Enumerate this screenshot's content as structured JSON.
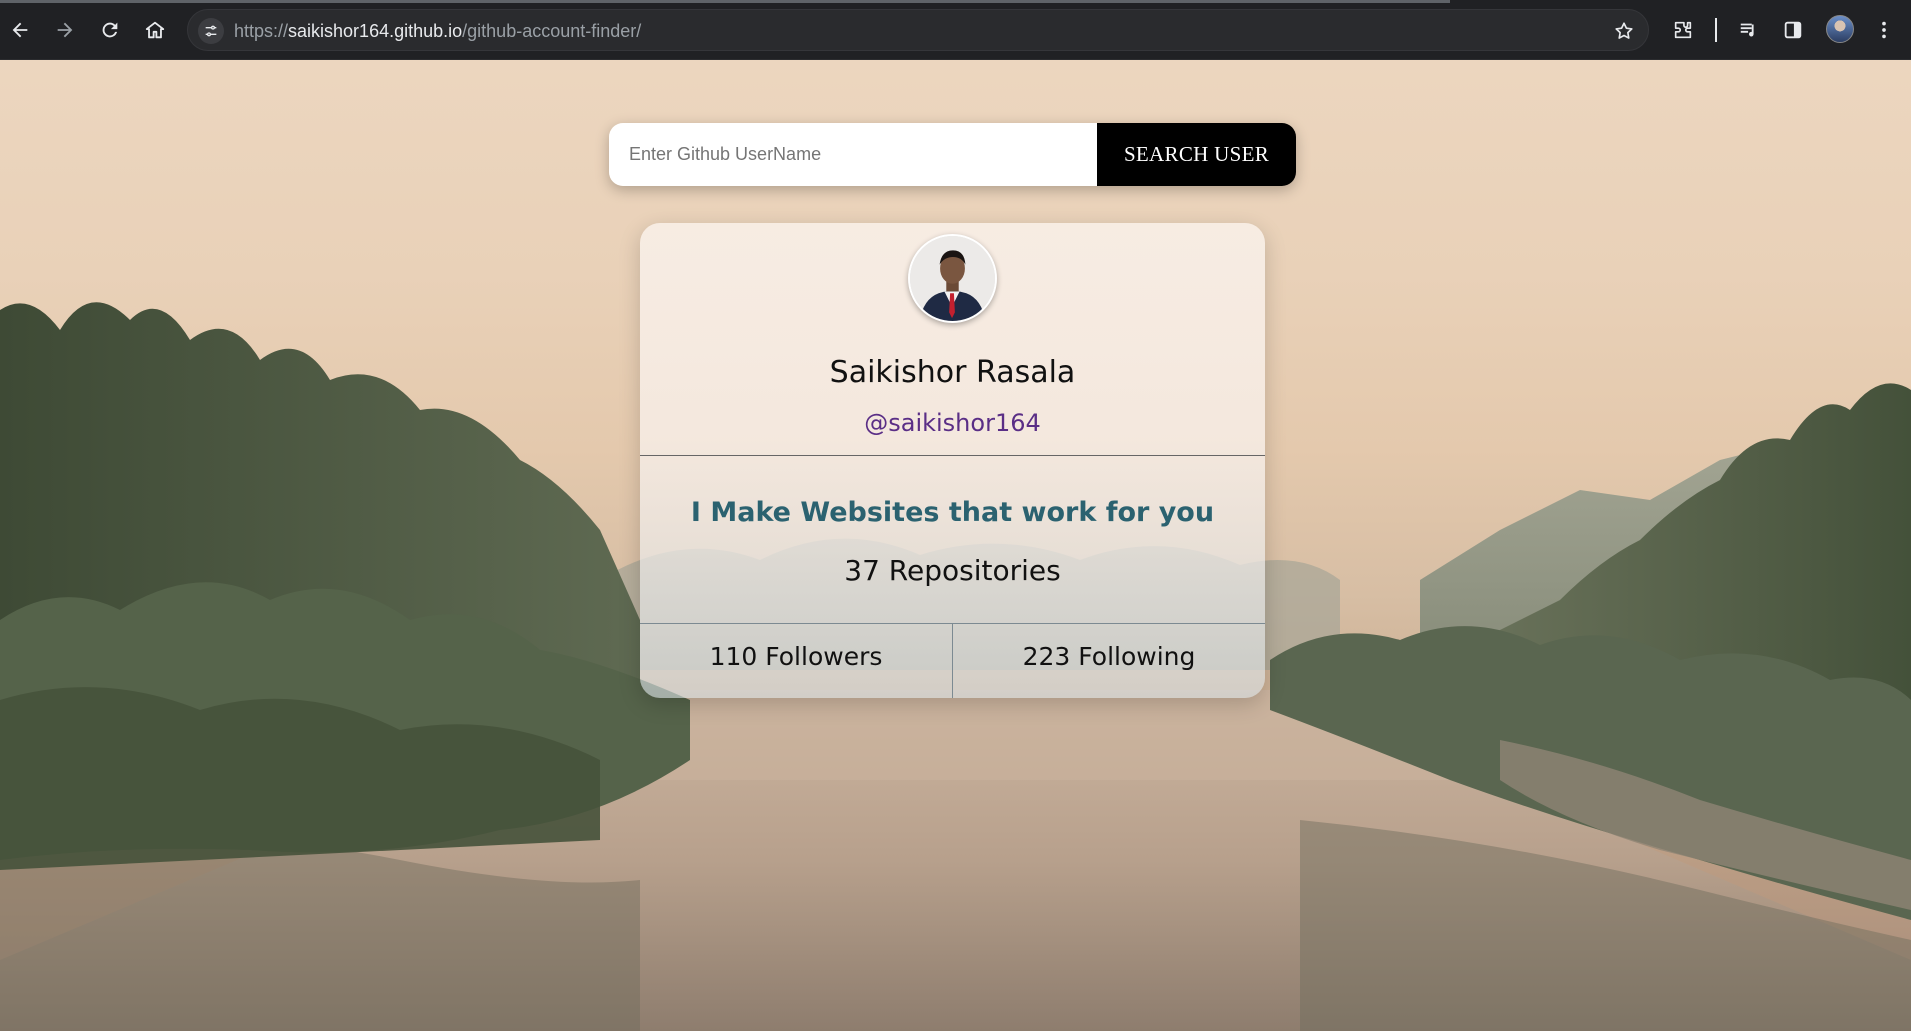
{
  "browser": {
    "url_prefix": "https://",
    "url_host": "saikishor164.github.io",
    "url_path": "/github-account-finder/"
  },
  "search": {
    "placeholder": "Enter Github UserName",
    "value": "",
    "button_label": "SEARCH USER"
  },
  "profile": {
    "name": "Saikishor Rasala",
    "handle": "@saikishor164",
    "bio": "I Make Websites that work for you",
    "repositories": "37 Repositories",
    "followers": "110 Followers",
    "following": "223 Following"
  },
  "colors": {
    "bio_accent": "#2b6270",
    "handle_accent": "#5a2e86",
    "button_bg": "#000000"
  }
}
